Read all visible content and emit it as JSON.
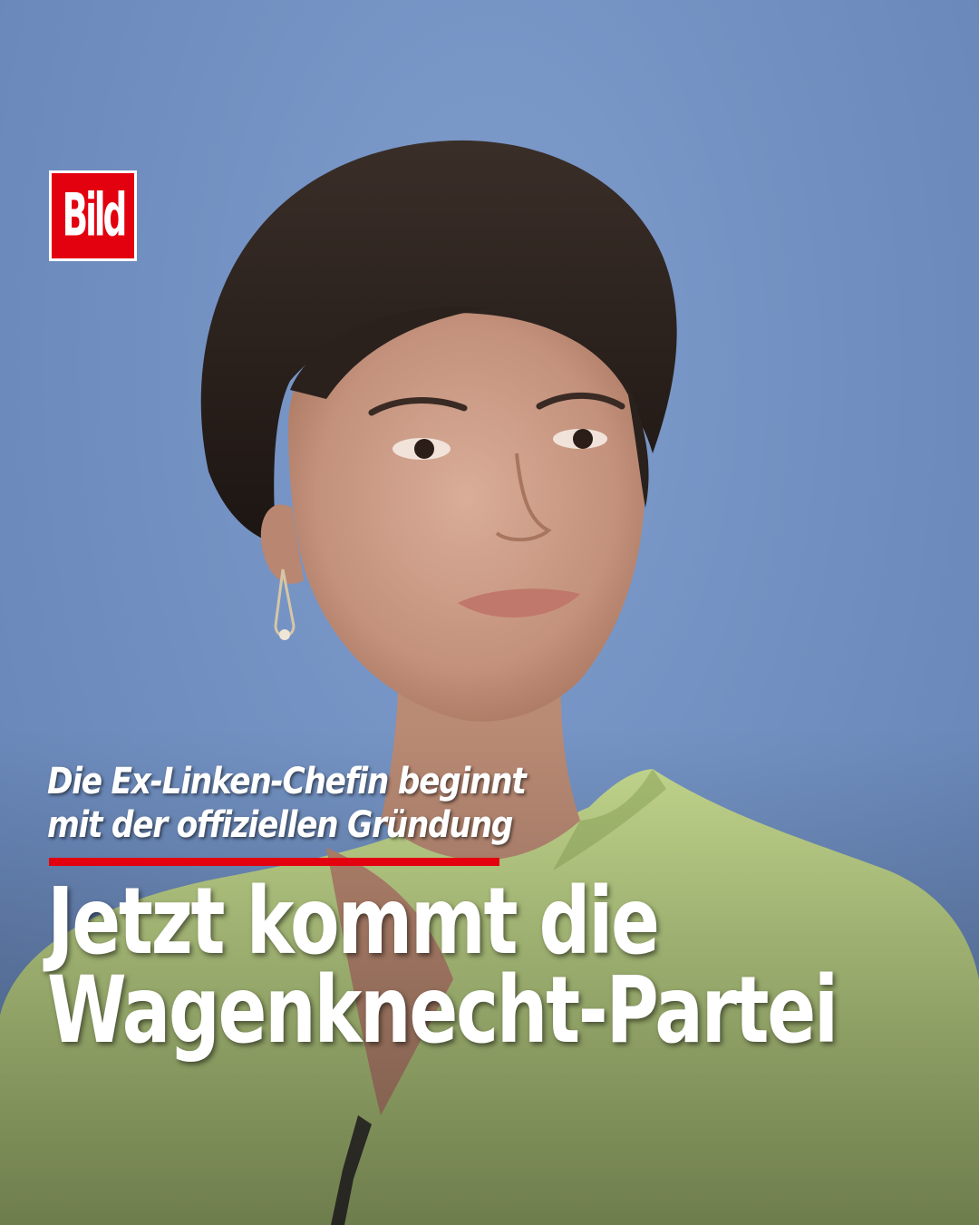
{
  "brand": {
    "logo_text": "Bild",
    "accent_color": "#e3000f",
    "text_color": "#ffffff",
    "background_color": "#7291c2"
  },
  "post": {
    "subline_line1": "Die Ex-Linken-Chefin beginnt",
    "subline_line2": "mit der offiziellen Gründung",
    "headline_line1": "Jetzt kommt die",
    "headline_line2": "Wagenknecht-Partei"
  },
  "photo": {
    "subject": "woman-portrait",
    "jacket_color": "#b9cf83",
    "hair_color": "#2a211d",
    "skin_color": "#c99a86"
  }
}
